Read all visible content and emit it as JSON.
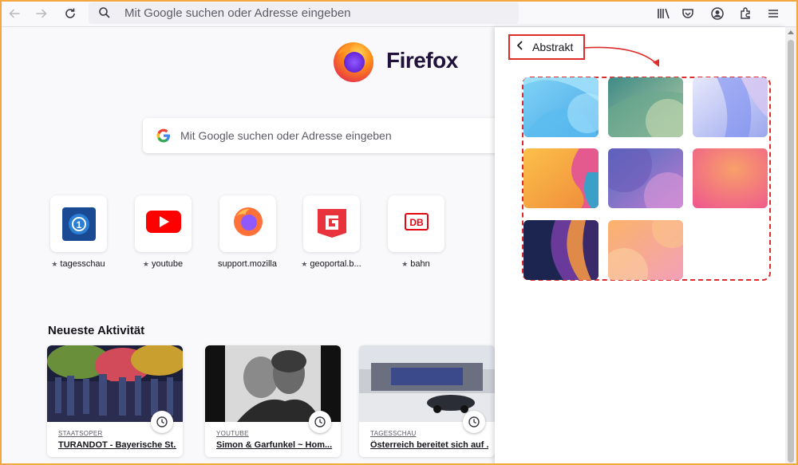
{
  "toolbar": {
    "url_placeholder": "Mit Google suchen oder Adresse eingeben"
  },
  "newtab": {
    "brand": "Firefox",
    "search_placeholder": "Mit Google suchen oder Adresse eingeben",
    "shortcuts": [
      {
        "label": "tagesschau",
        "pinned": true
      },
      {
        "label": "youtube",
        "pinned": true
      },
      {
        "label": "support.mozilla",
        "pinned": false
      },
      {
        "label": "geoportal.b...",
        "pinned": true
      },
      {
        "label": "bahn",
        "pinned": true
      }
    ],
    "recent_title": "Neueste Aktivität",
    "recent": [
      {
        "source": "STAATSOPER",
        "title": "TURANDOT - Bayerische St..."
      },
      {
        "source": "YOUTUBE",
        "title": "Simon & Garfunkel ~ Hom..."
      },
      {
        "source": "TAGESSCHAU",
        "title": "Österreich bereitet sich auf ..."
      }
    ]
  },
  "panel": {
    "back_label": "Abstrakt",
    "wallpapers": [
      "wallpaper-blue-waves",
      "wallpaper-teal-green",
      "wallpaper-lavender",
      "wallpaper-orange-pink",
      "wallpaper-purple-blue",
      "wallpaper-coral-pink",
      "wallpaper-dark-navy",
      "wallpaper-peach"
    ]
  },
  "colors": {
    "annotation": "#e02b2b",
    "frame": "#f4a640"
  }
}
